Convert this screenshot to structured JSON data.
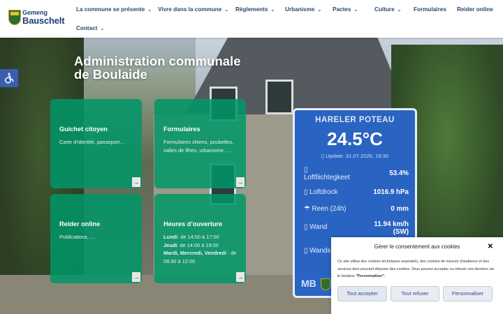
{
  "header": {
    "logo_line1": "Gemeng",
    "logo_line2": "Bauschelt",
    "nav": [
      {
        "label": "La commune se présente",
        "dropdown": true
      },
      {
        "label": "Vivre dans la commune",
        "dropdown": true
      },
      {
        "label": "Règlements",
        "dropdown": true
      },
      {
        "label": "Urbanisme",
        "dropdown": true
      },
      {
        "label": "Pactes",
        "dropdown": true
      },
      {
        "label": "Culture",
        "dropdown": true
      },
      {
        "label": "Formulaires",
        "dropdown": false
      },
      {
        "label": "Reider online",
        "dropdown": false
      },
      {
        "label": "Contact",
        "dropdown": true
      }
    ]
  },
  "hero": {
    "title_line1": "Administration communale",
    "title_line2": "de Boulaide"
  },
  "cards": [
    {
      "title": "Guichet citoyen",
      "text": "Carte d’identité, passeport…"
    },
    {
      "title": "Formulaires",
      "text": "Formulaires chiens, poubelles, salles de fêtes, urbanisme, …"
    },
    {
      "title": "Reider online",
      "text": "Publications, …"
    },
    {
      "title": "Heures d’ouverture",
      "hours": [
        {
          "days": "Lundi",
          "time": ": de 14:00 à 17:00"
        },
        {
          "days": "Jeudi",
          "time": ": de 14:00 à 19:00"
        },
        {
          "days": "Mardi, Mercredi, Vendredi",
          "time": " : de 08:30 à 12:00"
        }
      ]
    }
  ],
  "weather": {
    "station": "HARELER POTEAU",
    "temperature": "24.5°C",
    "update": "Update: 31.07.2026, 19:30",
    "rows": [
      {
        "label": "Loftfiichtegkeet",
        "value": "53.4%"
      },
      {
        "label": "Loftdrock",
        "value": "1016.9 hPa"
      },
      {
        "label": "Reen (24h)",
        "value": "0 mm"
      },
      {
        "label": "Wand",
        "value": "11.94 km/h (SW)"
      },
      {
        "label": "Wands",
        "value": ""
      }
    ],
    "logo": "MB"
  },
  "cookie": {
    "title": "Gérer le consentement aux cookies",
    "text": "Ce site utilise des cookies techniques essentiels, des cookies de mesure d'audience et des services tiers pouvant déposer des cookies. Vous pouvez accepter ou refuser ces derniers via le boutons ",
    "text_bold": "\"Personnaliser\".",
    "accept": "Tout accepter",
    "refuse": "Tout refuser",
    "customize": "Personnaliser"
  }
}
